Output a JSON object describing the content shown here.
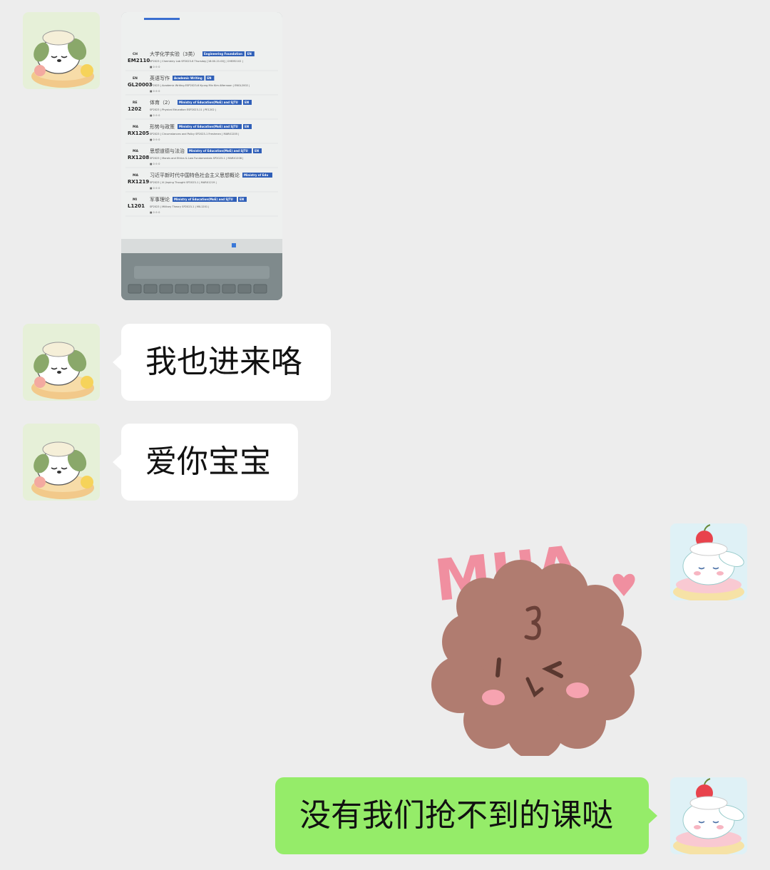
{
  "messages": [
    {
      "type": "image",
      "sender": "friend"
    },
    {
      "type": "text",
      "sender": "friend",
      "text": "我也进来咯"
    },
    {
      "type": "text",
      "sender": "friend",
      "text": "爱你宝宝"
    },
    {
      "type": "sticker",
      "sender": "me",
      "sticker_text": "MUA"
    },
    {
      "type": "text",
      "sender": "me",
      "text": "没有我们抢不到的课哒"
    }
  ],
  "course_photo": {
    "rows": [
      {
        "code_top": "CH",
        "code": "EM2110",
        "name": "大学化学实验（3类）",
        "tags": [
          "Engineering Foundation",
          "EN"
        ],
        "detail": "SP2023 | Chemistry Lab SP2023-6 Thursday [18:00-21:00] | CHEM2102 |"
      },
      {
        "code_top": "EN",
        "code": "GL20003",
        "name": "英语写作",
        "tags": [
          "Academic Writing",
          "EN"
        ],
        "detail": "SP2023 | Academic Writing ESP2023-6 Kyung Min Kim Afternoon | ENGL2002 |"
      },
      {
        "code_top": "RE",
        "code": "1202",
        "name": "体育（2）",
        "tags": [
          "Ministry of Education(MoE) and SJTU",
          "EN"
        ],
        "detail": "SP2023 | Physical Education ESP2023-11 | PE1202 |"
      },
      {
        "code_top": "MA",
        "code": "RX1205",
        "name": "形势与政策",
        "tags": [
          "Ministry of Education(MoE) and SJTU",
          "EN"
        ],
        "detail": "SP2023 | Circumstances and Policy SP2023-1 Freshmen | MARX1205 |"
      },
      {
        "code_top": "MA",
        "code": "RX1208",
        "name": "思想道德与法治",
        "tags": [
          "Ministry of Education(MoE) and SJTU",
          "EN"
        ],
        "detail": "SP2023 | Morals and Ethics & Law Fundamentals SP2023-1 | MARX1208 |"
      },
      {
        "code_top": "MA",
        "code": "RX1219",
        "name": "习近平新时代中国特色社会主义思想概论",
        "tags": [
          "Ministry of Edu"
        ],
        "detail": "SP2023 | Xi Jinping Thought SP2023-1 | MARX1219 |"
      },
      {
        "code_top": "MI",
        "code": "L1201",
        "name": "军事理论",
        "tags": [
          "Ministry of Education(MoE) and SJTU",
          "EN"
        ],
        "detail": "SP2023 | Military Theory SP2023-1 | MIL1201 |"
      }
    ]
  },
  "colors": {
    "background": "#ededed",
    "incoming_bubble": "#ffffff",
    "outgoing_bubble": "#95ec69",
    "sticker_text": "#f08fa0",
    "sticker_dog": "#b07c70"
  }
}
